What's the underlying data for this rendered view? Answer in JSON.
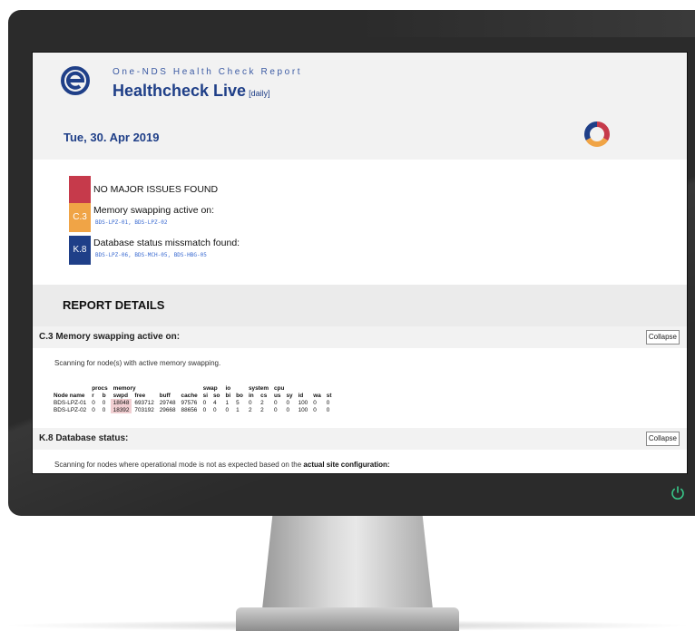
{
  "header": {
    "subtitle": "One-NDS Health Check Report",
    "title": "Healthcheck Live",
    "title_tag": "[daily]",
    "date": "Tue, 30. Apr 2019"
  },
  "summary": {
    "items": [
      {
        "code": "",
        "color": "#c63a4b",
        "text": "NO MAJOR ISSUES FOUND",
        "sub": ""
      },
      {
        "code": "C.3",
        "color": "#f0a446",
        "text": "Memory swapping active on:",
        "sub": "BDS-LPZ-01, BDS-LPZ-02"
      },
      {
        "code": "K.8",
        "color": "#1f3f88",
        "text": "Database status missmatch found:",
        "sub": "BDS-LPZ-06, BDS-MCH-05, BDS-HBG-05"
      }
    ]
  },
  "report": {
    "heading": "REPORT DETAILS",
    "sections": [
      {
        "title": "C.3 Memory swapping active on:",
        "collapse_label": "Collapse",
        "scan_text": "Scanning for node(s) with active memory swapping.",
        "table": {
          "group_headers": [
            "procs",
            "memory",
            "swap",
            "io",
            "system",
            "cpu"
          ],
          "columns": [
            "Node name",
            "r",
            "b",
            "swpd",
            "free",
            "buff",
            "cache",
            "si",
            "so",
            "bi",
            "bo",
            "in",
            "cs",
            "us",
            "sy",
            "id",
            "wa",
            "st"
          ],
          "rows": [
            [
              "BDS-LPZ-01",
              "0",
              "0",
              "18048",
              "693712",
              "29748",
              "97576",
              "0",
              "4",
              "1",
              "5",
              "0",
              "2",
              "0",
              "0",
              "100",
              "0",
              "0"
            ],
            [
              "BDS-LPZ-02",
              "0",
              "0",
              "18392",
              "703192",
              "29668",
              "88656",
              "0",
              "0",
              "0",
              "1",
              "2",
              "2",
              "0",
              "0",
              "100",
              "0",
              "0"
            ]
          ]
        }
      },
      {
        "title": "K.8 Database status:",
        "collapse_label": "Collapse",
        "scan_text_prefix": "Scanning for nodes where operational mode is not as expected based on the",
        "scan_text_bold": "actual site configuration:"
      }
    ]
  }
}
